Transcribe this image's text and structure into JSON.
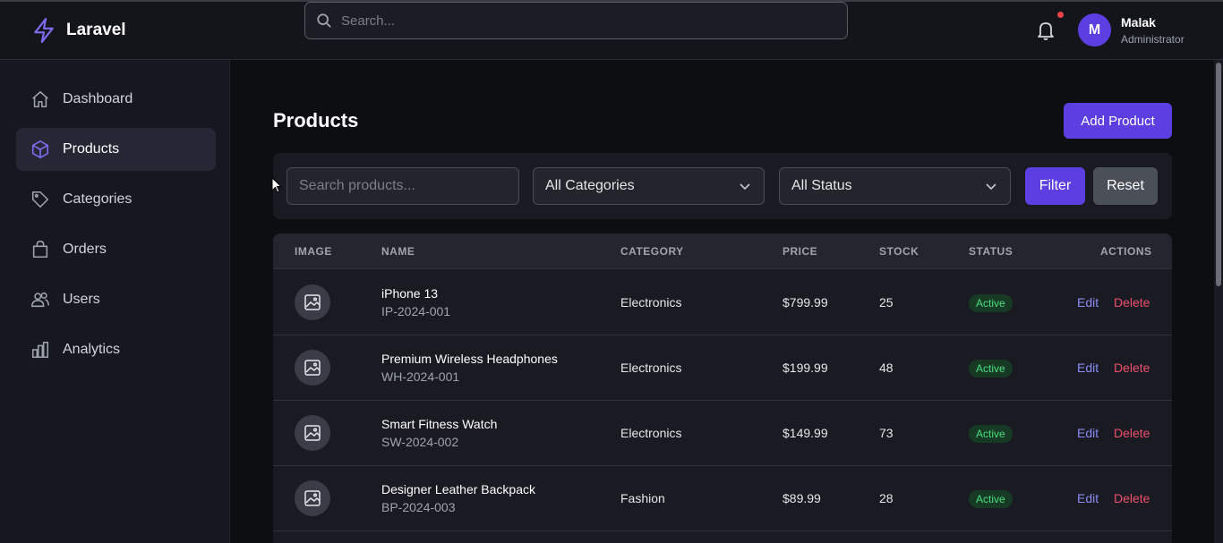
{
  "app": {
    "name": "Laravel"
  },
  "header": {
    "search_placeholder": "Search...",
    "user": {
      "initial": "M",
      "name": "Malak",
      "role": "Administrator"
    }
  },
  "sidebar": {
    "items": [
      {
        "label": "Dashboard",
        "icon": "home-icon",
        "active": false
      },
      {
        "label": "Products",
        "icon": "cube-icon",
        "active": true
      },
      {
        "label": "Categories",
        "icon": "tag-icon",
        "active": false
      },
      {
        "label": "Orders",
        "icon": "shopping-bag-icon",
        "active": false
      },
      {
        "label": "Users",
        "icon": "users-icon",
        "active": false
      },
      {
        "label": "Analytics",
        "icon": "bar-chart-icon",
        "active": false
      }
    ]
  },
  "main": {
    "title": "Products",
    "add_button": "Add Product",
    "filters": {
      "search_placeholder": "Search products...",
      "category_value": "All Categories",
      "status_value": "All Status",
      "filter_button": "Filter",
      "reset_button": "Reset"
    },
    "table": {
      "columns": [
        "IMAGE",
        "NAME",
        "CATEGORY",
        "PRICE",
        "STOCK",
        "STATUS",
        "ACTIONS"
      ],
      "edit_label": "Edit",
      "delete_label": "Delete",
      "rows": [
        {
          "name": "iPhone 13",
          "sku": "IP-2024-001",
          "category": "Electronics",
          "price": "$799.99",
          "stock": "25",
          "status": "Active"
        },
        {
          "name": "Premium Wireless Headphones",
          "sku": "WH-2024-001",
          "category": "Electronics",
          "price": "$199.99",
          "stock": "48",
          "status": "Active"
        },
        {
          "name": "Smart Fitness Watch",
          "sku": "SW-2024-002",
          "category": "Electronics",
          "price": "$149.99",
          "stock": "73",
          "status": "Active"
        },
        {
          "name": "Designer Leather Backpack",
          "sku": "BP-2024-003",
          "category": "Fashion",
          "price": "$89.99",
          "stock": "28",
          "status": "Active"
        }
      ]
    }
  },
  "colors": {
    "accent": "#5b3fe0",
    "status_active": "#4ade80",
    "delete": "#f0506e",
    "edit": "#8b8cf6"
  }
}
